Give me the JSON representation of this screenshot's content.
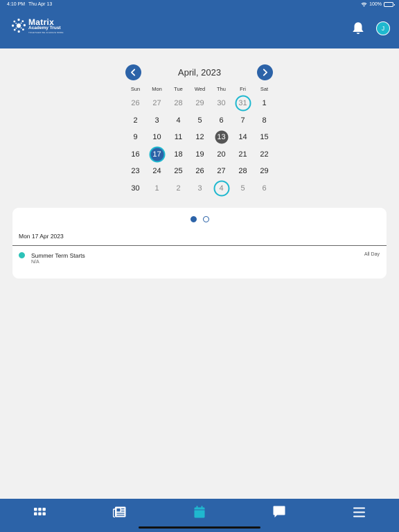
{
  "status_bar": {
    "time": "4:10 PM",
    "date": "Thu Apr 13",
    "battery": "100%"
  },
  "header": {
    "logo": {
      "line1": "Matrix",
      "line2": "Academy Trust",
      "line3": "TOGETHER WE ACHIEVE MORE"
    },
    "avatar_initial": "J"
  },
  "calendar": {
    "month_title": "April, 2023",
    "weekdays": [
      "Sun",
      "Mon",
      "Tue",
      "Wed",
      "Thu",
      "Fri",
      "Sat"
    ],
    "weeks": [
      [
        "26",
        "27",
        "28",
        "29",
        "30",
        "31",
        "1"
      ],
      [
        "2",
        "3",
        "4",
        "5",
        "6",
        "7",
        "8"
      ],
      [
        "9",
        "10",
        "11",
        "12",
        "13",
        "14",
        "15"
      ],
      [
        "16",
        "17",
        "18",
        "19",
        "20",
        "21",
        "22"
      ],
      [
        "23",
        "24",
        "25",
        "26",
        "27",
        "28",
        "29"
      ],
      [
        "30",
        "1",
        "2",
        "3",
        "4",
        "5",
        "6"
      ]
    ]
  },
  "agenda": {
    "date": "Mon 17 Apr 2023",
    "events": [
      {
        "title": "Summer Term Starts",
        "subtitle": "N/A",
        "time": "All Day"
      }
    ]
  },
  "colors": {
    "brand": "#2c63a8",
    "accent": "#1fb8cf",
    "event": "#2cc2b8",
    "today": "#555555"
  },
  "tabbar": {
    "items": [
      {
        "icon": "apps-grid-icon"
      },
      {
        "icon": "newspaper-icon"
      },
      {
        "icon": "calendar-icon",
        "active": true
      },
      {
        "icon": "chat-bubble-icon"
      },
      {
        "icon": "menu-icon"
      }
    ]
  }
}
